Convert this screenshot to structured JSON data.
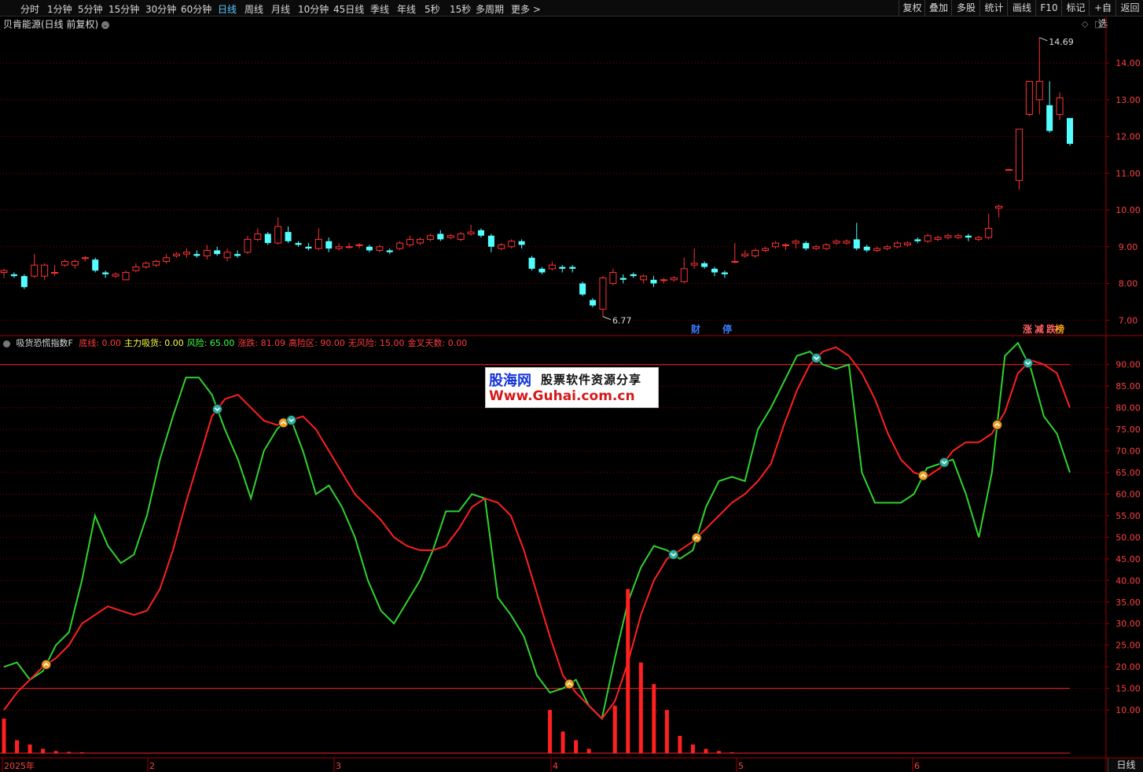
{
  "toolbar": {
    "timeframes": [
      "分时",
      "1分钟",
      "5分钟",
      "15分钟",
      "30分钟",
      "60分钟",
      "日线",
      "周线",
      "月线",
      "10分钟",
      "45日线",
      "季线",
      "年线",
      "5秒",
      "15秒",
      "多周期",
      "更多 >"
    ],
    "active": "日线",
    "right_buttons": [
      "复权",
      "叠加",
      "多股",
      "统计",
      "画线",
      "F10",
      "标记",
      "+自选",
      "返回"
    ]
  },
  "price_panel": {
    "title": "贝肯能源(日线 前复权)",
    "high_label": "14.69",
    "low_label": "6.77",
    "markers": [
      "财",
      "停",
      "涨",
      "减",
      "跌",
      "榜"
    ]
  },
  "indicator_panel": {
    "name": "吸货恐慌指数F",
    "params": [
      {
        "label": "底线: 0.00",
        "color": "#ff3b3b"
      },
      {
        "label": "主力吸货: 0.00",
        "color": "#ffff40"
      },
      {
        "label": "风险: 65.00",
        "color": "#40ff40"
      },
      {
        "label": "涨跌: 81.09",
        "color": "#ff3b3b"
      },
      {
        "label": "高险区: 90.00",
        "color": "#ff3b3b"
      },
      {
        "label": "无风险: 15.00",
        "color": "#ff3b3b"
      },
      {
        "label": "金叉天数: 0.00",
        "color": "#ff3b3b"
      }
    ]
  },
  "x_axis": {
    "labels": [
      "2025年",
      "2",
      "3",
      "4",
      "5",
      "6"
    ],
    "bottom_right": "日线"
  },
  "watermark": {
    "line1": "股海网",
    "line2": "股票软件资源分享",
    "line3": "Www.Guhai.com.cn"
  },
  "colors": {
    "up": "#ff3232",
    "down": "#54ffff",
    "green_line": "#2ed42e",
    "red_line": "#ff2020",
    "grid": "#8a0000"
  },
  "chart_data": [
    {
      "type": "candlestick",
      "title": "贝肯能源(日线 前复权)",
      "ylim": [
        6.6,
        14.9
      ],
      "y_ticks": [
        7.0,
        8.0,
        9.0,
        10.0,
        11.0,
        12.0,
        13.0,
        14.0
      ],
      "candles": [
        [
          8.3,
          8.35,
          8.15,
          8.4
        ],
        [
          8.25,
          8.2,
          8.15,
          8.3
        ],
        [
          8.2,
          7.9,
          7.85,
          8.25
        ],
        [
          8.2,
          8.5,
          8.15,
          8.8
        ],
        [
          8.2,
          8.5,
          8.1,
          8.55
        ],
        [
          8.3,
          8.3,
          8.2,
          8.5
        ],
        [
          8.5,
          8.6,
          8.45,
          8.65
        ],
        [
          8.5,
          8.6,
          8.4,
          8.65
        ],
        [
          8.7,
          8.7,
          8.6,
          8.75
        ],
        [
          8.65,
          8.35,
          8.3,
          8.7
        ],
        [
          8.3,
          8.25,
          8.15,
          8.35
        ],
        [
          8.2,
          8.25,
          8.15,
          8.3
        ],
        [
          8.1,
          8.3,
          8.1,
          8.35
        ],
        [
          8.35,
          8.45,
          8.3,
          8.55
        ],
        [
          8.45,
          8.55,
          8.4,
          8.6
        ],
        [
          8.5,
          8.6,
          8.45,
          8.65
        ],
        [
          8.6,
          8.7,
          8.55,
          8.8
        ],
        [
          8.75,
          8.8,
          8.7,
          8.85
        ],
        [
          8.8,
          8.85,
          8.7,
          8.95
        ],
        [
          8.8,
          8.75,
          8.7,
          8.9
        ],
        [
          8.75,
          8.9,
          8.65,
          9.05
        ],
        [
          8.9,
          8.8,
          8.75,
          9.0
        ],
        [
          8.7,
          8.85,
          8.6,
          8.95
        ],
        [
          8.8,
          8.75,
          8.7,
          8.9
        ],
        [
          8.85,
          9.2,
          8.8,
          9.3
        ],
        [
          9.2,
          9.35,
          9.15,
          9.5
        ],
        [
          9.35,
          9.1,
          9.05,
          9.4
        ],
        [
          9.1,
          9.55,
          9.05,
          9.8
        ],
        [
          9.4,
          9.15,
          9.1,
          9.55
        ],
        [
          9.1,
          9.05,
          9.0,
          9.15
        ],
        [
          9.0,
          8.95,
          8.9,
          9.1
        ],
        [
          8.95,
          9.2,
          8.9,
          9.5
        ],
        [
          9.15,
          8.95,
          8.85,
          9.25
        ],
        [
          8.95,
          9.0,
          8.9,
          9.1
        ],
        [
          9.0,
          9.0,
          8.95,
          9.1
        ],
        [
          9.05,
          9.05,
          8.95,
          9.1
        ],
        [
          9.0,
          8.9,
          8.85,
          9.05
        ],
        [
          8.9,
          9.0,
          8.85,
          9.05
        ],
        [
          8.9,
          8.85,
          8.8,
          8.95
        ],
        [
          8.95,
          9.1,
          8.9,
          9.15
        ],
        [
          9.05,
          9.2,
          9.0,
          9.3
        ],
        [
          9.1,
          9.2,
          9.05,
          9.25
        ],
        [
          9.2,
          9.3,
          9.15,
          9.35
        ],
        [
          9.35,
          9.2,
          9.15,
          9.45
        ],
        [
          9.25,
          9.3,
          9.2,
          9.35
        ],
        [
          9.2,
          9.35,
          9.15,
          9.4
        ],
        [
          9.35,
          9.4,
          9.3,
          9.6
        ],
        [
          9.45,
          9.3,
          9.25,
          9.5
        ],
        [
          9.3,
          9.0,
          8.85,
          9.35
        ],
        [
          8.95,
          9.05,
          8.9,
          9.1
        ],
        [
          9.0,
          9.15,
          8.95,
          9.2
        ],
        [
          9.15,
          9.05,
          8.95,
          9.2
        ],
        [
          8.7,
          8.4,
          8.35,
          8.75
        ],
        [
          8.4,
          8.3,
          8.25,
          8.45
        ],
        [
          8.4,
          8.5,
          8.35,
          8.6
        ],
        [
          8.45,
          8.4,
          8.3,
          8.5
        ],
        [
          8.45,
          8.4,
          8.3,
          8.5
        ],
        [
          8.0,
          7.7,
          7.65,
          8.05
        ],
        [
          7.55,
          7.4,
          7.35,
          7.6
        ],
        [
          7.3,
          8.15,
          7.1,
          8.2
        ],
        [
          8.0,
          8.3,
          7.95,
          8.4
        ],
        [
          8.15,
          8.1,
          8.0,
          8.25
        ],
        [
          8.25,
          8.2,
          8.15,
          8.3
        ],
        [
          8.1,
          8.2,
          8.0,
          8.25
        ],
        [
          8.1,
          8.0,
          7.9,
          8.2
        ],
        [
          8.1,
          8.1,
          8.0,
          8.15
        ],
        [
          8.1,
          8.15,
          8.05,
          8.2
        ],
        [
          8.05,
          8.4,
          8.0,
          8.7
        ],
        [
          8.5,
          8.55,
          8.4,
          8.95
        ],
        [
          8.55,
          8.45,
          8.4,
          8.6
        ],
        [
          8.4,
          8.3,
          8.2,
          8.45
        ],
        [
          8.3,
          8.25,
          8.15,
          8.35
        ],
        [
          8.6,
          8.6,
          8.55,
          9.1
        ],
        [
          8.75,
          8.8,
          8.7,
          8.9
        ],
        [
          8.75,
          8.9,
          8.7,
          8.95
        ],
        [
          8.9,
          8.95,
          8.85,
          9.0
        ],
        [
          9.0,
          9.1,
          8.95,
          9.15
        ],
        [
          9.05,
          9.05,
          8.9,
          9.1
        ],
        [
          9.1,
          9.15,
          8.95,
          9.2
        ],
        [
          9.1,
          8.95,
          8.9,
          9.15
        ],
        [
          8.95,
          9.0,
          8.9,
          9.05
        ],
        [
          8.95,
          9.05,
          8.9,
          9.1
        ],
        [
          9.1,
          9.15,
          9.05,
          9.2
        ],
        [
          9.1,
          9.15,
          9.05,
          9.2
        ],
        [
          9.2,
          8.95,
          8.9,
          9.65
        ],
        [
          9.0,
          8.9,
          8.85,
          9.05
        ],
        [
          8.9,
          8.95,
          8.85,
          9.0
        ],
        [
          8.95,
          9.0,
          8.9,
          9.05
        ],
        [
          9.0,
          9.1,
          8.95,
          9.15
        ],
        [
          9.05,
          9.1,
          9.0,
          9.15
        ],
        [
          9.2,
          9.15,
          9.1,
          9.25
        ],
        [
          9.15,
          9.3,
          9.1,
          9.35
        ],
        [
          9.2,
          9.25,
          9.15,
          9.3
        ],
        [
          9.25,
          9.3,
          9.2,
          9.35
        ],
        [
          9.25,
          9.3,
          9.2,
          9.35
        ],
        [
          9.3,
          9.25,
          9.15,
          9.35
        ],
        [
          9.2,
          9.25,
          9.15,
          9.3
        ],
        [
          9.25,
          9.5,
          9.2,
          9.9
        ],
        [
          10.05,
          10.1,
          9.8,
          10.15
        ],
        [
          11.1,
          11.1,
          11.1,
          11.1
        ],
        [
          10.8,
          12.2,
          10.55,
          12.2
        ],
        [
          12.6,
          13.5,
          12.55,
          13.5
        ],
        [
          13.0,
          13.5,
          12.6,
          14.69
        ],
        [
          12.85,
          12.15,
          12.1,
          13.5
        ],
        [
          12.6,
          13.05,
          12.45,
          13.2
        ],
        [
          12.5,
          11.8,
          11.75,
          12.5
        ]
      ]
    },
    {
      "type": "line",
      "title": "吸货恐慌指数F",
      "ylim": [
        0,
        96.5
      ],
      "y_ticks": [
        10,
        15,
        20,
        25,
        30,
        35,
        40,
        45,
        50,
        55,
        60,
        65,
        70,
        75,
        80,
        85,
        90
      ],
      "x_labels": [
        "2025年",
        "2",
        "3",
        "4",
        "5",
        "6"
      ],
      "reference_lines": [
        90,
        15
      ],
      "series": [
        {
          "name": "风险",
          "color": "#2ed42e",
          "values": [
            20,
            21,
            17,
            19,
            25,
            28,
            40,
            55,
            48,
            44,
            46,
            55,
            68,
            78,
            87,
            87,
            83,
            75,
            68,
            59,
            70,
            75,
            78,
            70,
            60,
            62,
            57,
            50,
            40,
            33,
            30,
            35,
            40,
            47,
            56,
            56,
            60,
            59,
            36,
            32,
            27,
            18,
            14,
            15,
            17,
            11,
            8,
            22,
            35,
            43,
            48,
            47,
            45,
            47,
            57,
            63,
            64,
            63,
            75,
            80,
            86,
            92,
            93,
            90,
            89,
            90,
            65,
            58,
            58,
            58,
            60,
            66,
            67,
            68,
            60,
            50,
            65,
            92,
            95,
            89,
            78,
            74,
            65
          ]
        },
        {
          "name": "涨跌",
          "color": "#ff2020",
          "values": [
            10,
            14,
            17,
            20,
            22,
            25,
            30,
            32,
            34,
            33,
            32,
            33,
            38,
            47,
            58,
            68,
            78,
            82,
            83,
            80,
            77,
            76,
            77,
            78,
            75,
            70,
            65,
            60,
            57,
            54,
            50,
            48,
            47,
            47,
            48,
            52,
            57,
            59,
            58,
            55,
            47,
            37,
            27,
            18,
            14,
            11,
            8,
            12,
            21,
            32,
            40,
            45,
            47,
            49,
            52,
            55,
            58,
            60,
            63,
            67,
            76,
            84,
            90,
            93,
            94,
            92,
            88,
            82,
            74,
            68,
            65,
            64,
            66,
            70,
            72,
            72,
            74,
            79,
            88,
            91,
            90,
            88,
            80
          ]
        },
        {
          "name": "",
          "color": "#ff2020",
          "type": "bar",
          "values": [
            8,
            3,
            2,
            1,
            0.5,
            0.3,
            0.2,
            0,
            0,
            0,
            0,
            0,
            0,
            0,
            0,
            0,
            0,
            0,
            0,
            0,
            0,
            0,
            0,
            0,
            0,
            0,
            0,
            0,
            0,
            0,
            0,
            0,
            0,
            0,
            0,
            0,
            0,
            0,
            0,
            0,
            0,
            0,
            10,
            5,
            3,
            1,
            0,
            11,
            38,
            21,
            16,
            10,
            4,
            2,
            1,
            0.5,
            0.2,
            0,
            0,
            0,
            0,
            0,
            0,
            0,
            0,
            0,
            0,
            0,
            0,
            0,
            0,
            0,
            0,
            0,
            0,
            0,
            0,
            0,
            0,
            0,
            0,
            0,
            0
          ]
        }
      ]
    }
  ]
}
